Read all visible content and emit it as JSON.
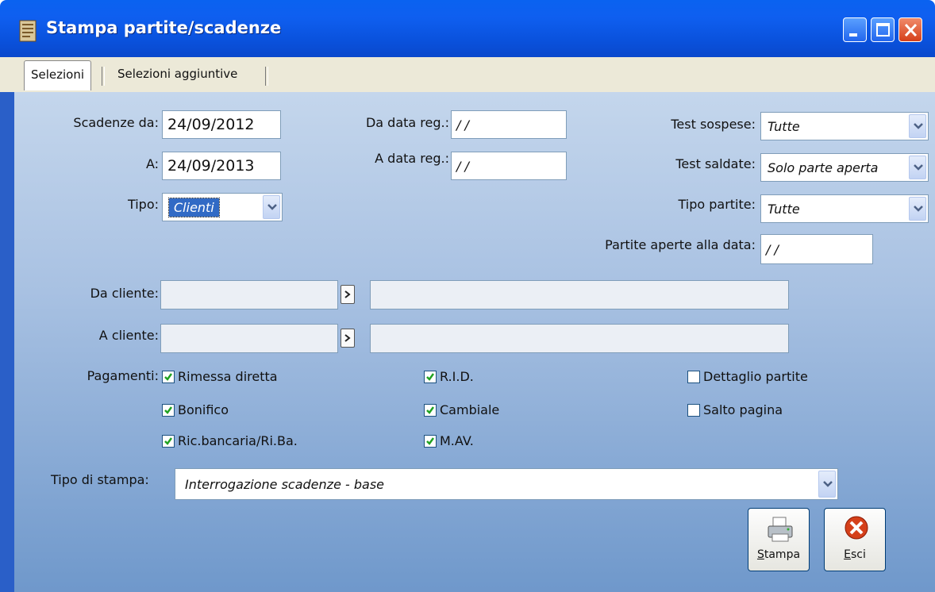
{
  "window": {
    "title": "Stampa partite/scadenze"
  },
  "tabs": [
    {
      "label": "Selezioni"
    },
    {
      "label": "Selezioni aggiuntive"
    }
  ],
  "form": {
    "scadenze_da": {
      "label": "Scadenze da:",
      "value": "24/09/2012"
    },
    "scadenze_a": {
      "label": "A:",
      "value": "24/09/2013"
    },
    "tipo": {
      "label": "Tipo:",
      "value": "Clienti"
    },
    "da_data_reg": {
      "label": "Da data reg.:",
      "value": " /  /"
    },
    "a_data_reg": {
      "label": "A data reg.:",
      "value": " /  /"
    },
    "test_sospese": {
      "label": "Test sospese:",
      "value": "Tutte"
    },
    "test_saldate": {
      "label": "Test saldate:",
      "value": "Solo parte aperta"
    },
    "tipo_partite": {
      "label": "Tipo partite:",
      "value": "Tutte"
    },
    "partite_aperte": {
      "label": "Partite aperte alla data:",
      "value": " /  /"
    },
    "da_cliente": {
      "label": "Da cliente:",
      "value": "",
      "desc": ""
    },
    "a_cliente": {
      "label": "A cliente:",
      "value": "",
      "desc": ""
    },
    "pagamenti_label": "Pagamenti:",
    "checkboxes": {
      "rimessa": {
        "label": "Rimessa diretta",
        "checked": true
      },
      "bonifico": {
        "label": "Bonifico",
        "checked": true
      },
      "riba": {
        "label": "Ric.bancaria/Ri.Ba.",
        "checked": true
      },
      "rid": {
        "label": "R.I.D.",
        "checked": true
      },
      "cambiale": {
        "label": "Cambiale",
        "checked": true
      },
      "mav": {
        "label": "M.AV.",
        "checked": true
      },
      "dettaglio": {
        "label": "Dettaglio partite",
        "checked": false
      },
      "salto": {
        "label": "Salto pagina",
        "checked": false
      }
    },
    "tipo_stampa": {
      "label": "Tipo di stampa:",
      "value": "Interrogazione scadenze - base"
    }
  },
  "buttons": {
    "stampa": {
      "prefix": "S",
      "rest": "tampa"
    },
    "esci": {
      "prefix": "E",
      "rest": "sci"
    }
  },
  "colors": {
    "titlebar": "#0a5ae6",
    "check": "#21a121",
    "close": "#d5401a"
  }
}
